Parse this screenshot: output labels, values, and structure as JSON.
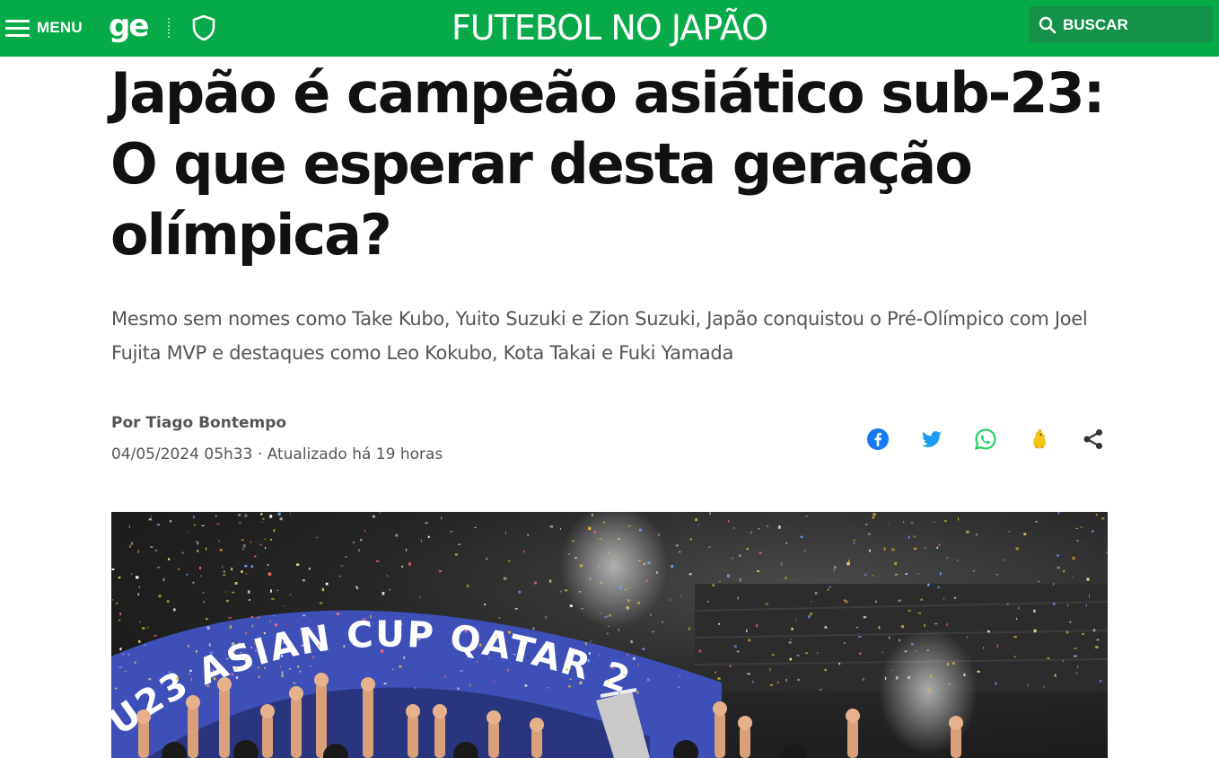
{
  "header": {
    "menu_label": "MENU",
    "logo_text": "ge",
    "section_title": "FUTEBOL NO JAPÃO",
    "search_label": "BUSCAR",
    "brand_color": "#06aa48"
  },
  "article": {
    "headline": "Japão é campeão asiático sub-23: O que esperar desta geração olímpica?",
    "subtitle": "Mesmo sem nomes como Take Kubo, Yuito Suzuki e Zion Suzuki, Japão conquistou o Pré-Olímpico com Joel Fujita MVP e destaques como Leo Kokubo, Kota Takai e Fuki Yamada",
    "author": "Por Tiago Bontempo",
    "date": "04/05/2024 05h33 · Atualizado há 19 horas"
  },
  "share": {
    "icons": [
      "facebook-icon",
      "twitter-icon",
      "whatsapp-icon",
      "kwai-icon",
      "share-icon"
    ],
    "colors": {
      "facebook": "#1877f2",
      "twitter": "#1d9bf0",
      "whatsapp": "#25d366",
      "kwai": "#f5c518",
      "share": "#333333"
    }
  },
  "photo": {
    "banner_text": "U23 ASIAN CUP QATAR 2",
    "banner_color": "#3f4fb8"
  }
}
